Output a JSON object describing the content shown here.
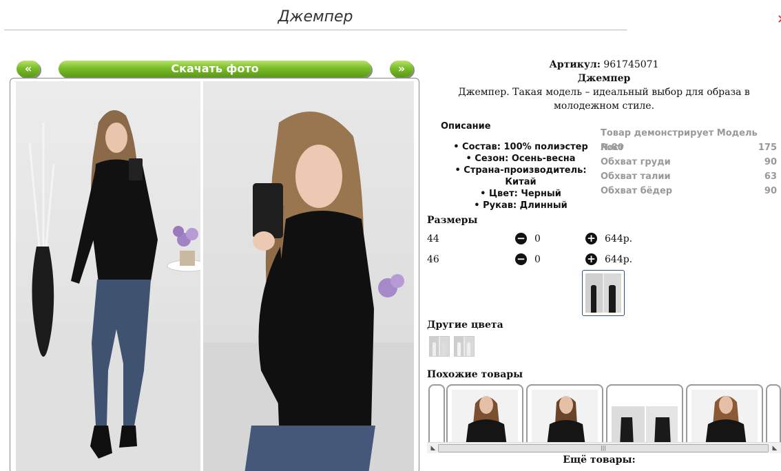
{
  "page": {
    "title": "Джемпер"
  },
  "gallery": {
    "prev_label": "«",
    "next_label": "»",
    "download_label": "Скачать фото"
  },
  "product": {
    "sku_label": "Артикул:",
    "sku_value": "961745071",
    "name": "Джемпер",
    "description": "Джемпер. Такая модель – идеальный выбор для образа в молодежном стиле."
  },
  "description": {
    "heading": "Описание",
    "items": [
      "• Состав: 100% полиэстер",
      "• Сезон: Осень-весна",
      "• Страна-производитель: Китай",
      "• Цвет: Черный",
      "• Рукав: Длинный"
    ]
  },
  "model": {
    "heading": "Товар демонстрирует Модель №80",
    "rows": [
      {
        "label": "Рост",
        "value": "175"
      },
      {
        "label": "Обхват груди",
        "value": "90"
      },
      {
        "label": "Обхват талии",
        "value": "63"
      },
      {
        "label": "Обхват бёдер",
        "value": "90"
      }
    ]
  },
  "sizes": {
    "heading": "Размеры",
    "rows": [
      {
        "size": "44",
        "minus": "−",
        "qty": "0",
        "plus": "+",
        "price": "644р."
      },
      {
        "size": "46",
        "minus": "−",
        "qty": "0",
        "plus": "+",
        "price": "644р."
      }
    ]
  },
  "other_colors": {
    "heading": "Другие цвета"
  },
  "similar": {
    "heading": "Похожие товары"
  },
  "scrollbar": {
    "left": "◣",
    "right": "◣",
    "grip": "|||"
  },
  "more_products": {
    "label": "Ещё товары:"
  },
  "colors": {
    "button_green": "#7bbd2a",
    "accent_red": "#d22222",
    "muted_text": "#999999"
  }
}
